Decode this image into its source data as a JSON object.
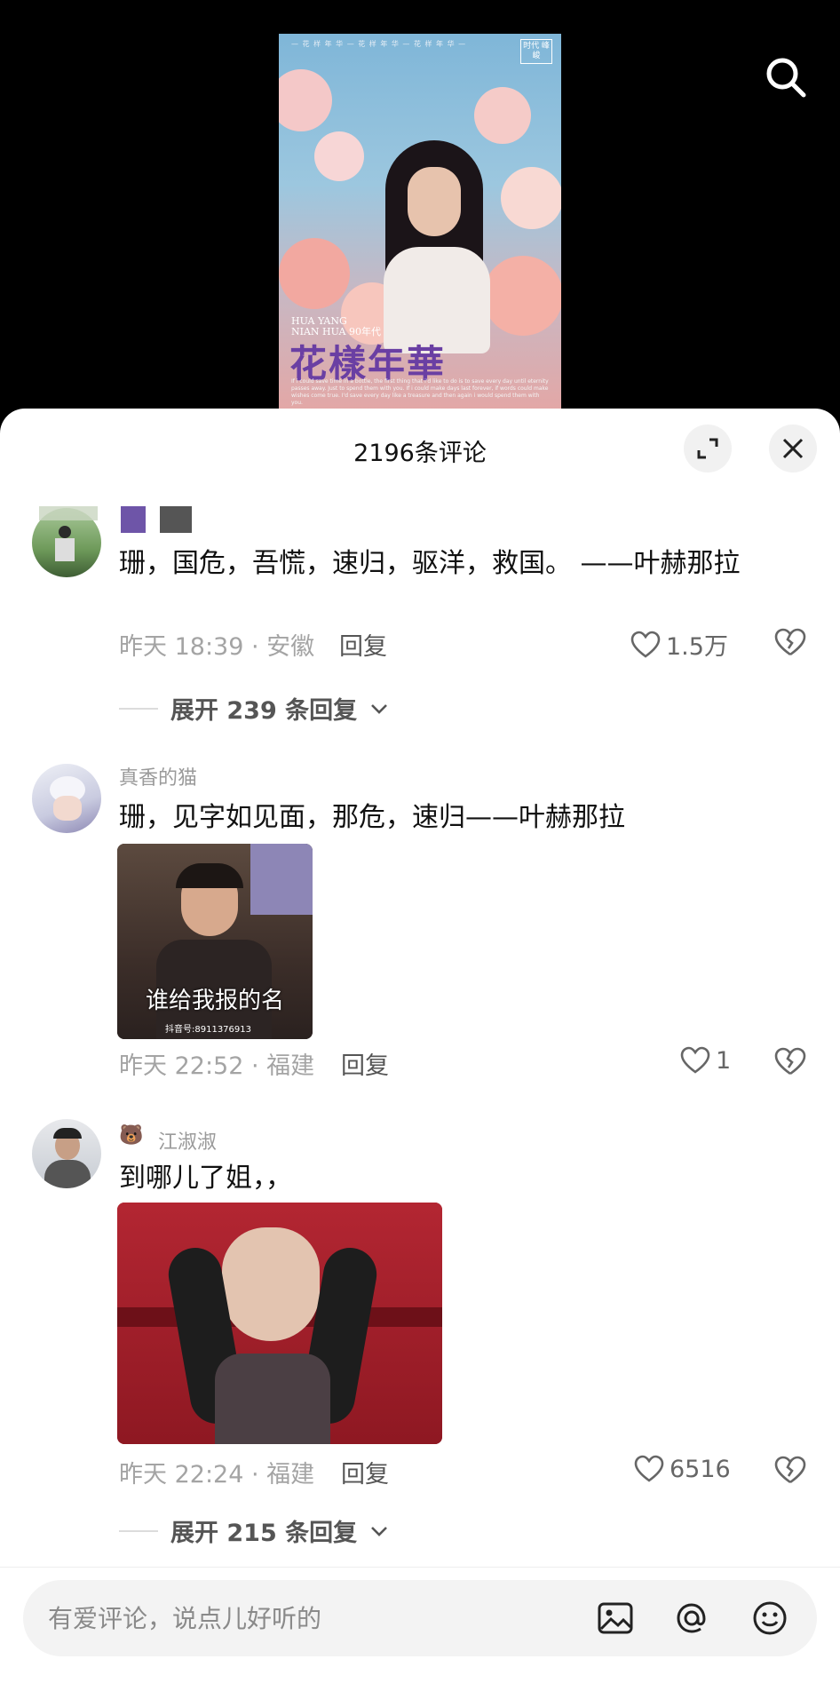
{
  "poster": {
    "topline": "— 花 样 年 华 —  花 样 年 华  — 花 样 年 华 —",
    "badge": "时代 峰峻",
    "sub_line1": "HUA YANG",
    "sub_line2": "NIAN HUA 90年代",
    "title": "花樣年華",
    "fine_text": "If i could save time in a bottle, the first thing that i'd like to do is to save every day until eternity passes away. Just to spend them with you. If i could make days last forever, if words could make wishes come true. I'd save every day like a treasure and then again i would spend them with you."
  },
  "header": {
    "title": "2196条评论"
  },
  "comments": [
    {
      "username": "",
      "text": "珊，国危，吾慌，速归，驱洋，救国。    ——叶赫那拉",
      "time": "昨天 18:39 · 安徽",
      "reply_label": "回复",
      "likes": "1.5万",
      "expand_label": "展开 239 条回复"
    },
    {
      "username": "真香的猫",
      "text": "珊，见字如见面，那危，速归——叶赫那拉",
      "image_caption": "谁给我报的名",
      "image_watermark": "抖音号:8911376913",
      "time": "昨天 22:52 · 福建",
      "reply_label": "回复",
      "likes": "1"
    },
    {
      "username": "江淑淑",
      "text": "到哪儿了姐，，",
      "time": "昨天 22:24 · 福建",
      "reply_label": "回复",
      "likes": "6516",
      "expand_label": "展开 215 条回复"
    }
  ],
  "input": {
    "placeholder": "有爱评论，说点儿好听的"
  },
  "icons": {
    "search": "search-icon",
    "expand": "expand-icon",
    "close": "close-icon",
    "heart": "heart-icon",
    "broken_heart": "dislike-icon",
    "chevron": "chevron-down-icon",
    "image": "image-icon",
    "at": "at-icon",
    "emoji": "emoji-icon"
  },
  "colors": {
    "poster_title": "#6a3fa3",
    "sheet_bg": "#ffffff",
    "meta_text": "#a4a4a4"
  }
}
